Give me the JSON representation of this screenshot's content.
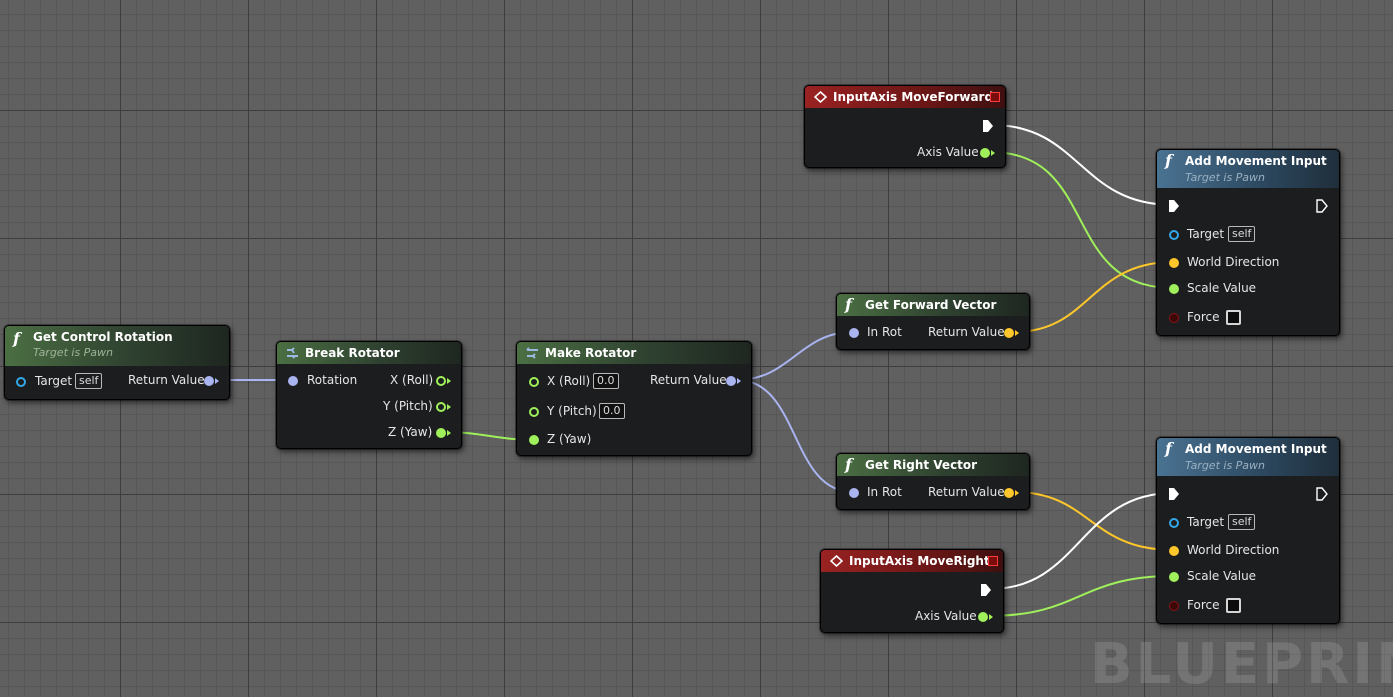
{
  "graph": {
    "watermark": "BLUEPRINT"
  },
  "nodes": {
    "get_control_rotation": {
      "title": "Get Control Rotation",
      "subtitle": "Target is Pawn",
      "target_label": "Target",
      "target_default": "self",
      "return_label": "Return Value"
    },
    "break_rotator": {
      "title": "Break Rotator",
      "rotation_label": "Rotation",
      "x_label": "X (Roll)",
      "y_label": "Y (Pitch)",
      "z_label": "Z (Yaw)"
    },
    "make_rotator": {
      "title": "Make Rotator",
      "x_label": "X (Roll)",
      "x_value": "0.0",
      "y_label": "Y (Pitch)",
      "y_value": "0.0",
      "z_label": "Z (Yaw)",
      "return_label": "Return Value"
    },
    "input_move_forward": {
      "title": "InputAxis MoveForward",
      "axis_label": "Axis Value"
    },
    "get_forward_vector": {
      "title": "Get Forward Vector",
      "in_label": "In Rot",
      "return_label": "Return Value"
    },
    "get_right_vector": {
      "title": "Get Right Vector",
      "in_label": "In Rot",
      "return_label": "Return Value"
    },
    "input_move_right": {
      "title": "InputAxis MoveRight",
      "axis_label": "Axis Value"
    },
    "add_movement_1": {
      "title": "Add Movement Input",
      "subtitle": "Target is Pawn",
      "target_label": "Target",
      "target_default": "self",
      "world_dir_label": "World Direction",
      "scale_label": "Scale Value",
      "force_label": "Force"
    },
    "add_movement_2": {
      "title": "Add Movement Input",
      "subtitle": "Target is Pawn",
      "target_label": "Target",
      "target_default": "self",
      "world_dir_label": "World Direction",
      "scale_label": "Scale Value",
      "force_label": "Force"
    }
  },
  "colors": {
    "exec_wire": "#ffffff",
    "float_wire": "#9ff05a",
    "vector_wire": "#fdc62a",
    "rotator_wire": "#a9b4f0",
    "function_header": "#4b6f43",
    "target_function_header": "#4a7392",
    "event_header": "#9a2222"
  },
  "icons": {
    "function": "f-function-icon",
    "break": "break-struct-icon",
    "make": "make-struct-icon",
    "event": "event-diamond-icon"
  }
}
